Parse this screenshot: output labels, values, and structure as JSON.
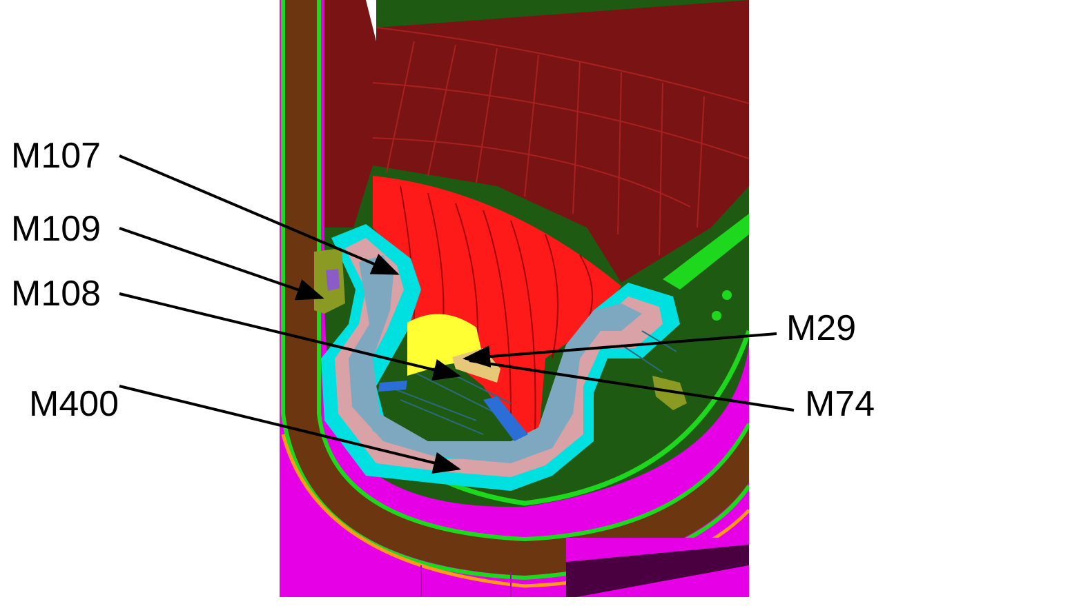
{
  "colors": {
    "magenta": "#e600e6",
    "brown": "#6b3610",
    "green": "#1ed81e",
    "dark_green": "#1f5a12",
    "dark_red": "#7a1414",
    "red": "#ff1a1a",
    "cyan": "#00e0e0",
    "pink": "#d8a2a6",
    "steel_blue": "#7ea8bf",
    "yellow": "#ffff33",
    "tan": "#e6c878",
    "orange": "#ff9a1a",
    "purple": "#8a5cc8",
    "olive": "#8a9a22",
    "blue": "#2b6fd6",
    "arrow": "#000000"
  },
  "labels": {
    "m107": "M107",
    "m109": "M109",
    "m108": "M108",
    "m400": "M400",
    "m29": "M29",
    "m74": "M74"
  }
}
